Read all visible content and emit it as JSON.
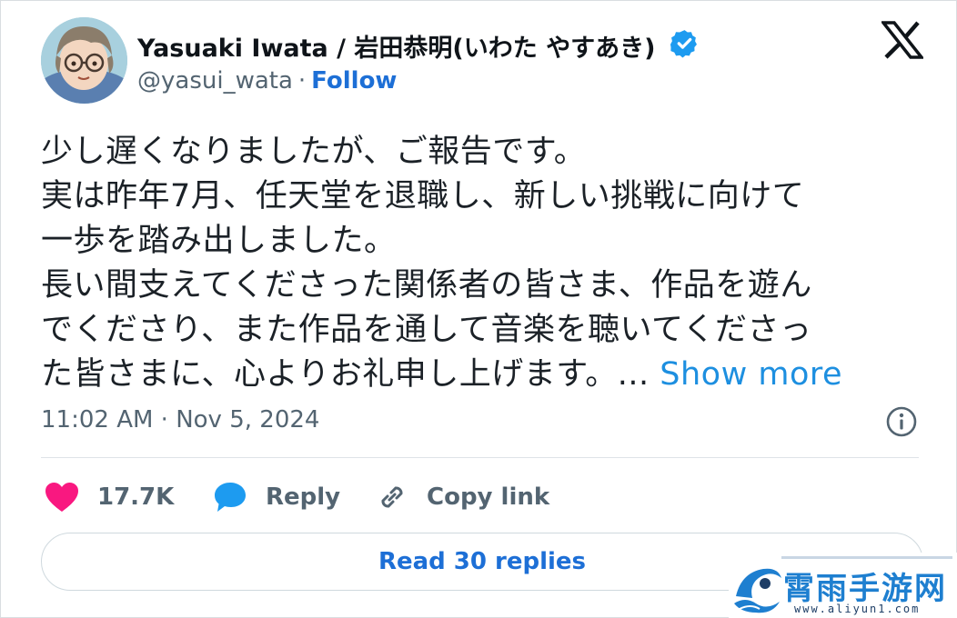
{
  "author": {
    "display_name": "Yasuaki Iwata / 岩田恭明(いわた やすあき)",
    "handle": "@yasui_wata",
    "separator": "·",
    "follow_label": "Follow"
  },
  "icons": {
    "brand": "x-logo",
    "verified": "verified-badge-icon",
    "info": "info-icon",
    "like": "heart-icon",
    "reply": "speech-bubble-icon",
    "copy": "link-icon"
  },
  "tweet": {
    "lines": [
      "少し遅くなりましたが、ご報告です。",
      "実は昨年7月、任天堂を退職し、新しい挑戦に向けて",
      "一歩を踏み出しました。",
      "長い間支えてくださった関係者の皆さま、作品を遊ん",
      "でくださり、また作品を通して音楽を聴いてくださっ",
      "た皆さまに、心よりお礼申し上げます。..."
    ],
    "show_more": "Show more",
    "timestamp": "11:02 AM · Nov 5, 2024"
  },
  "actions": {
    "likes": "17.7K",
    "reply_label": "Reply",
    "copy_label": "Copy link"
  },
  "read_replies": "Read 30 replies",
  "watermark": {
    "title": "霄雨手游网",
    "url": "www.aliyun1.com"
  },
  "colors": {
    "accent": "#1d6fd6",
    "like": "#f91880",
    "verified": "#1d9bf0",
    "muted": "#536471"
  }
}
